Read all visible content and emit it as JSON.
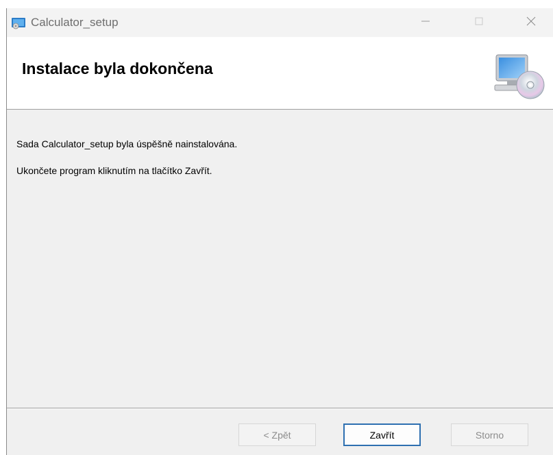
{
  "window": {
    "title": "Calculator_setup",
    "icons": {
      "app": "installer-app-icon",
      "minimize": "minimize-icon",
      "maximize": "maximize-icon",
      "close": "close-icon",
      "header_art": "computer-cd-icon"
    }
  },
  "header": {
    "title": "Instalace byla dokončena"
  },
  "content": {
    "line1": "Sada Calculator_setup byla úspěšně nainstalována.",
    "line2": "Ukončete program kliknutím na tlačítko Zavřít."
  },
  "buttons": {
    "back": "< Zpět",
    "finish": "Zavřít",
    "cancel": "Storno"
  },
  "colors": {
    "accent": "#2d6fb0",
    "window_bg": "#f0f0f0",
    "disabled_text": "#8c8c8c"
  }
}
